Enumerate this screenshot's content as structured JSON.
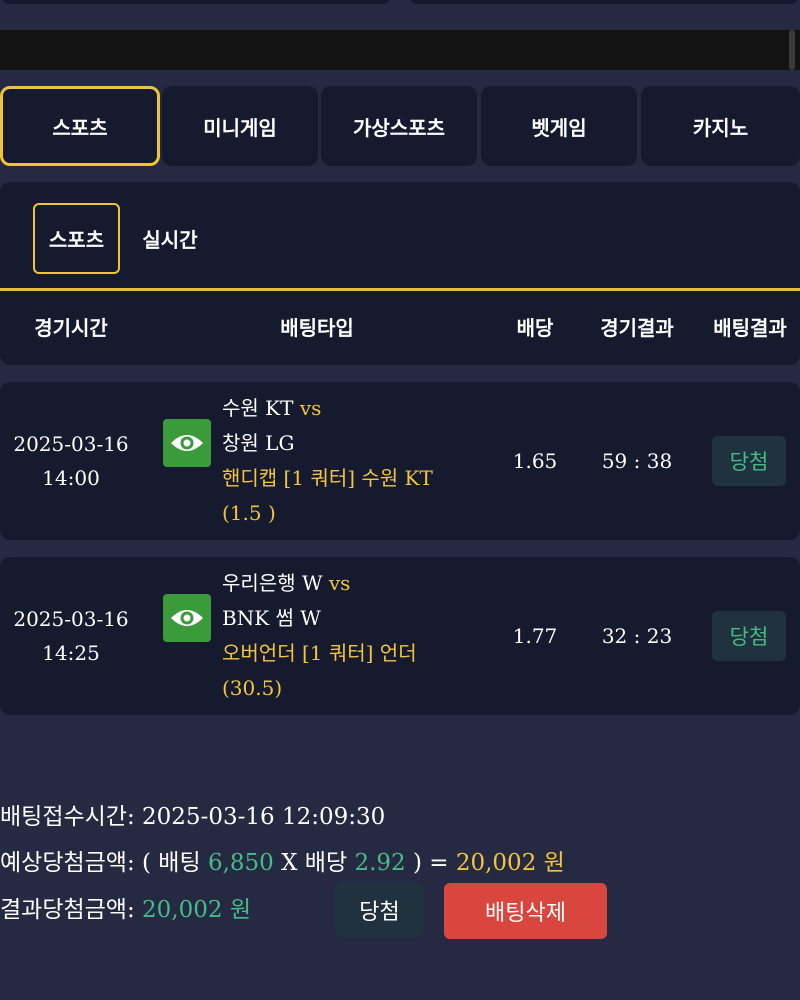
{
  "main_tabs": [
    "스포츠",
    "미니게임",
    "가상스포츠",
    "벳게임",
    "카지노"
  ],
  "sub_tabs": {
    "active": "스포츠",
    "live": "실시간"
  },
  "columns": [
    "경기시간",
    "배팅타입",
    "배당",
    "경기결과",
    "배팅결과"
  ],
  "bets": [
    {
      "date": "2025-03-16",
      "time": "14:00",
      "home": "수원 KT",
      "vs": "vs",
      "away": "창원 LG",
      "bet_line": "핸디캡 [1 쿼터] 수원 KT",
      "bet_value": "(1.5 )",
      "odds": "1.65",
      "score": "59 : 38",
      "result": "당첨"
    },
    {
      "date": "2025-03-16",
      "time": "14:25",
      "home": "우리은행 W",
      "vs": "vs",
      "away": "BNK 썸 W",
      "bet_line": "오버언더 [1 쿼터] 언더",
      "bet_value": "(30.5)",
      "odds": "1.77",
      "score": "32 : 23",
      "result": "당첨"
    }
  ],
  "summary": {
    "received_label": "배팅접수시간: ",
    "received_time": "2025-03-16 12:09:30",
    "expected_label": "예상당첨금액: ( 배팅 ",
    "stake": "6,850",
    "odds_label": " X 배당 ",
    "total_odds": "2.92",
    "equals": " ) = ",
    "expected_amount": "20,002 원",
    "result_label": "결과당첨금액: ",
    "result_amount": "20,002 원"
  },
  "buttons": {
    "win": "당첨",
    "delete": "배팅삭제"
  },
  "colors": {
    "accent": "#f0c33c",
    "win": "#45bb88",
    "delete": "#d9463e",
    "background": "#252a42",
    "panel": "#151a2f"
  },
  "icons": {
    "view": "eye-icon"
  }
}
